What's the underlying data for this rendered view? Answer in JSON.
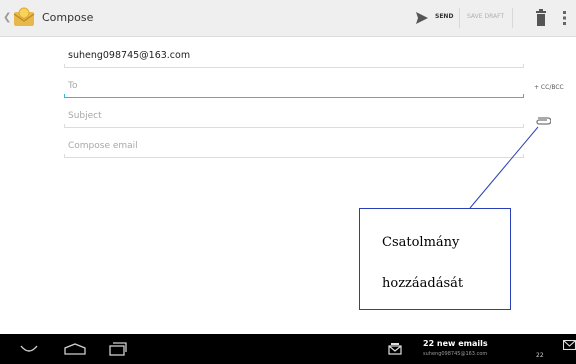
{
  "action_bar": {
    "title": "Compose",
    "send_label": "SEND",
    "save_draft_label": "SAVE DRAFT",
    "icons": [
      "chevron-left-icon",
      "email-app-icon",
      "send-icon",
      "trash-icon",
      "overflow-menu-icon"
    ]
  },
  "compose": {
    "from": "suheng098745@163.com",
    "to_placeholder": "To",
    "cc_bcc_label": "+ CC/BCC",
    "subject_placeholder": "Subject",
    "body_placeholder": "Compose email",
    "attach_icon": "paperclip-icon"
  },
  "callout": {
    "line1": "Csatolmány",
    "line2": "hozzáadását"
  },
  "system_bar": {
    "notification_title": "22 new emails",
    "notification_subtitle": "suheng098745@163.com",
    "notification_count": "22",
    "icons": [
      "back-icon",
      "home-icon",
      "recent-apps-icon",
      "email-notification-icon",
      "mail-icon"
    ]
  },
  "colors": {
    "accent": "#33b5e5",
    "callout_border": "#2a3fb7",
    "action_bar_bg": "#efefef",
    "system_bar_bg": "#000000"
  }
}
